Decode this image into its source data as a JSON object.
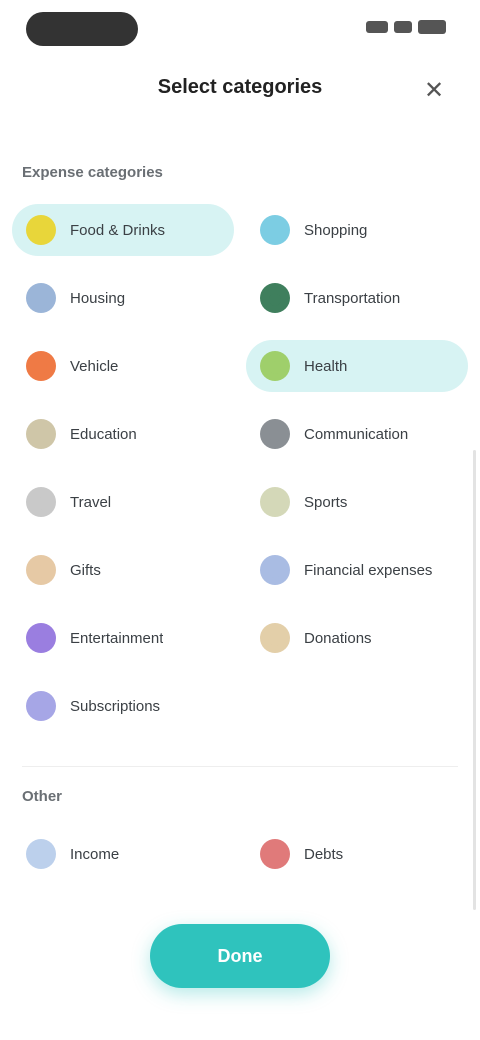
{
  "header": {
    "title": "Select categories",
    "close_glyph": "✕"
  },
  "sections": [
    {
      "title": "Expense categories",
      "items": [
        {
          "label": "Food & Drinks",
          "icon": "food-icon",
          "glyph": "●",
          "color": "#e8d63a",
          "selected": true
        },
        {
          "label": "Shopping",
          "icon": "shopping-icon",
          "glyph": "●",
          "color": "#7ccde3",
          "selected": false
        },
        {
          "label": "Housing",
          "icon": "home-icon",
          "glyph": "●",
          "color": "#9bb5d8",
          "selected": false
        },
        {
          "label": "Transportation",
          "icon": "car-icon",
          "glyph": "●",
          "color": "#3f7f5d",
          "selected": false
        },
        {
          "label": "Vehicle",
          "icon": "vehicle-icon",
          "glyph": "●",
          "color": "#ef7a45",
          "selected": false
        },
        {
          "label": "Health",
          "icon": "health-icon",
          "glyph": "●",
          "color": "#9fcf6b",
          "selected": true
        },
        {
          "label": "Education",
          "icon": "education-icon",
          "glyph": "●",
          "color": "#cfc6a8",
          "selected": false
        },
        {
          "label": "Communication",
          "icon": "phone-icon",
          "glyph": "●",
          "color": "#8a8f94",
          "selected": false
        },
        {
          "label": "Travel",
          "icon": "travel-icon",
          "glyph": "●",
          "color": "#c9c9c9",
          "selected": false
        },
        {
          "label": "Sports",
          "icon": "sports-icon",
          "glyph": "●",
          "color": "#d4d8b8",
          "selected": false
        },
        {
          "label": "Gifts",
          "icon": "gift-icon",
          "glyph": "●",
          "color": "#e6c9a5",
          "selected": false
        },
        {
          "label": "Financial expenses",
          "icon": "finance-icon",
          "glyph": "●",
          "color": "#a9bce3",
          "selected": false
        },
        {
          "label": "Entertainment",
          "icon": "entertainment-icon",
          "glyph": "●",
          "color": "#9a7ee0",
          "selected": false
        },
        {
          "label": "Donations",
          "icon": "donation-icon",
          "glyph": "●",
          "color": "#e3cfa9",
          "selected": false
        },
        {
          "label": "Subscriptions",
          "icon": "subscription-icon",
          "glyph": "●",
          "color": "#a6a6e6",
          "selected": false
        }
      ]
    },
    {
      "title": "Other",
      "items": [
        {
          "label": "Income",
          "icon": "income-icon",
          "glyph": "●",
          "color": "#bcd0ec",
          "selected": false
        },
        {
          "label": "Debts",
          "icon": "debt-icon",
          "glyph": "●",
          "color": "#e07a7a",
          "selected": false
        }
      ]
    }
  ],
  "action": {
    "done_label": "Done"
  },
  "colors": {
    "accent": "#2fc3bd",
    "selected_bg": "#d7f3f3"
  }
}
